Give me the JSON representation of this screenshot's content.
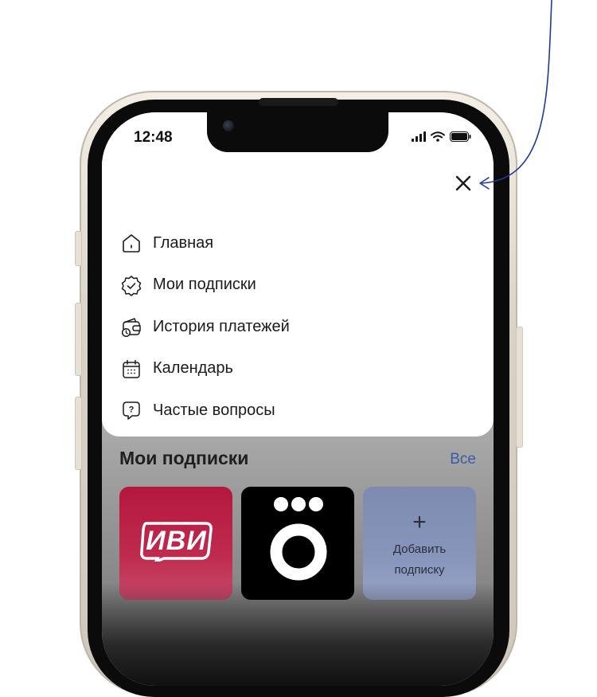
{
  "status_bar": {
    "time": "12:48",
    "icons": [
      "signal-icon",
      "wifi-icon",
      "battery-icon"
    ]
  },
  "menu": {
    "close_icon": "close-icon",
    "items": [
      {
        "label": "Главная",
        "icon": "home-icon"
      },
      {
        "label": "Мои подписки",
        "icon": "badge-check-icon"
      },
      {
        "label": "История платежей",
        "icon": "wallet-clock-icon"
      },
      {
        "label": "Календарь",
        "icon": "calendar-icon"
      },
      {
        "label": "Частые вопросы",
        "icon": "question-bubble-icon"
      }
    ]
  },
  "subscriptions": {
    "title": "Мои подписки",
    "see_all": "Все",
    "tiles": [
      {
        "logo_text": "ИВИ",
        "brand": "ivi",
        "color": "#b5173d"
      },
      {
        "brand": "okko",
        "color": "#000000"
      },
      {
        "plus": "+",
        "label_line1": "Добавить",
        "label_line2": "подписку"
      }
    ]
  },
  "colors": {
    "accent_link": "#3b5ba6",
    "annotation_arrow": "#1f3a9a"
  }
}
